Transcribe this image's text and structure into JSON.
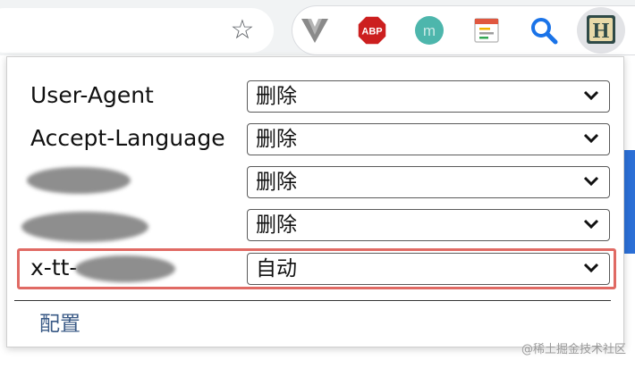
{
  "toolbar": {
    "star_icon": "star-icon",
    "extensions": [
      {
        "name": "v-icon",
        "color": "#7d7d7d"
      },
      {
        "name": "abp-icon",
        "label": "ABP",
        "color": "#cc1f1f"
      },
      {
        "name": "m-icon",
        "label": "m",
        "color": "#4db6ac"
      },
      {
        "name": "note-icon",
        "color": "#e9e9e9"
      },
      {
        "name": "search-icon",
        "color": "#1a73e8"
      },
      {
        "name": "h-icon",
        "label": "H",
        "color": "#2f4a47"
      }
    ]
  },
  "popup": {
    "headers": [
      {
        "label": "User-Agent",
        "value": "删除"
      },
      {
        "label": "Accept-Language",
        "value": "删除"
      },
      {
        "label": "",
        "value": "删除"
      },
      {
        "label": "",
        "value": "删除"
      },
      {
        "label": "x-tt-",
        "value": "自动"
      }
    ],
    "config_link": "配置"
  },
  "watermark": "@稀土掘金技术社区",
  "colors": {
    "highlight": "#e06a64",
    "link": "#3a5a86"
  }
}
